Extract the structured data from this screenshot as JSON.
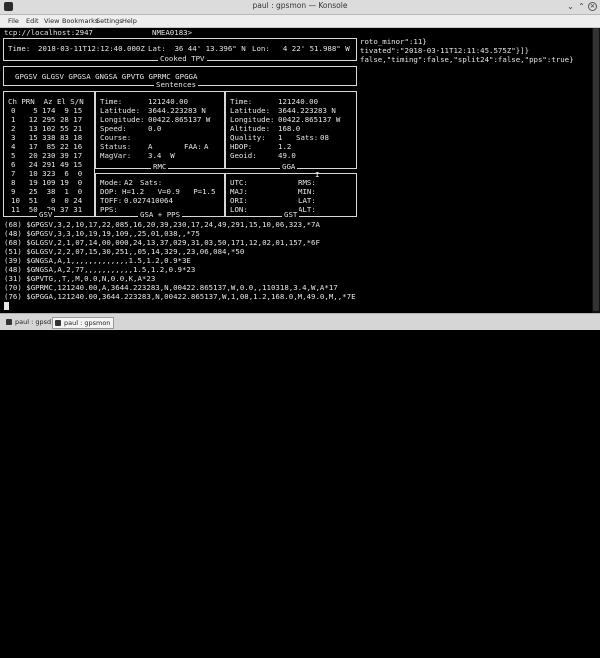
{
  "window": {
    "title": "paul : gpsmon — Konsole",
    "menu": [
      "File",
      "Edit",
      "View",
      "Bookmarks",
      "Settings",
      "Help"
    ]
  },
  "gpsmon": {
    "header_left": "tcp://localhost:2947",
    "header_right": "NMEA0183>",
    "cooked": {
      "time_label": "Time:",
      "time": "2018-03-11T12:12:40.000Z",
      "lat_label": "Lat:",
      "lat": " 36 44' 13.396\" N",
      "lon_label": "Lon:",
      "lon": "  4 22' 51.988\" W",
      "title": "Cooked TPV"
    },
    "sentences": {
      "list": "GPGSV GLGSV GPGSA GNGSA GPVTG GPRMC GPGGA",
      "title": "Sentences"
    },
    "gsv": {
      "title": "GSV",
      "header": "Ch PRN  Az El S/N",
      "rows": [
        "0    5 174  9 15",
        "1   12 295 28 17",
        "2   13 102 55 21",
        "3   15 338 83 18",
        "4   17  85 22 16",
        "5   20 230 39 17",
        "6   24 291 49 15",
        "7   10 323  6  0",
        "8   19 109 19  0",
        "9   25  38  1  0",
        "10  51   0  0 24",
        "11  50  29 37 31"
      ]
    },
    "rmc": {
      "title": "RMC",
      "time_label": "Time:",
      "time": "121240.00",
      "lat_label": "Latitude:",
      "lat": "3644.223283 N",
      "lon_label": "Longitude:",
      "lon": "00422.865137 W",
      "speed_label": "Speed:",
      "speed": "0.0",
      "course_label": "Course:",
      "course": "",
      "status_label": "Status:",
      "status": "A",
      "faa_label": "FAA:",
      "faa": "A",
      "magvar_label": "MagVar:",
      "magvar": "3.4  W"
    },
    "gga": {
      "title": "GGA",
      "time_label": "Time:",
      "time": "121240.00",
      "lat_label": "Latitude:",
      "lat": "3644.223283 N",
      "lon_label": "Longitude:",
      "lon": "00422.865137 W",
      "alt_label": "Altitude:",
      "alt": "168.0",
      "quality_label": "Quality:",
      "quality": "1",
      "sats_label": "Sats:",
      "sats": "08",
      "hdop_label": "HDOP:",
      "hdop": "1.2",
      "geoid_label": "Geoid:",
      "geoid": "49.0"
    },
    "gsa": {
      "title": "GSA + PPS",
      "mode_label": "Mode:",
      "mode": "A2",
      "sats_label": "Sats:",
      "sats": "",
      "dop_label": "DOP:",
      "dop": "H=1.2   V=0.9   P=1.5",
      "toff_label": "TOFF:",
      "toff": "0.027410064",
      "pps_label": "PPS:",
      "pps": ""
    },
    "gst": {
      "title": "GST",
      "utc_label": "UTC:",
      "rms_label": "RMS:",
      "maj_label": "MAJ:",
      "min_label": "MIN:",
      "ori_label": "ORI:",
      "lat_label": "LAT:",
      "lon_label": "LON:",
      "alt_label": "ALT:"
    },
    "json_overlay": [
      "roto_minor\":11}",
      "tivated\":\"2018-03-11T12:11:45.575Z\"}]}",
      "false,\"timing\":false,\"split24\":false,\"pps\":true}"
    ],
    "log": [
      "(68) $GPGSV,3,2,10,17,22,085,16,20,39,230,17,24,49,291,15,10,06,323,*7A",
      "(48) $GPGSV,3,3,10,19,19,109,,25,01,038,,*75",
      "(68) $GLGSV,2,1,07,14,00,000,24,13,37,029,31,03,50,171,12,02,01,157,*6F",
      "(51) $GLGSV,2,2,07,15,30,251,,05,14,329,,23,06,084,*50",
      "(39) $GNGSA,A,1,,,,,,,,,,,,,1.5,1.2,0.9*3E",
      "(48) $GNGSA,A,2,77,,,,,,,,,,,1.5,1.2,0.9*23",
      "(31) $GPVTG,,T,,M,0.0,N,0.0,K,A*23",
      "(70) $GPRMC,121240.00,A,3644.223283,N,00422.865137,W,0.0,,110318,3.4,W,A*17",
      "(76) $GPGGA,121240.00,3644.223283,N,00422.865137,W,1,08,1.2,168.0,M,49.0,M,,*7E"
    ]
  },
  "taskbar": {
    "tasks": [
      "paul : gpsd",
      "paul : gpsmon"
    ]
  }
}
